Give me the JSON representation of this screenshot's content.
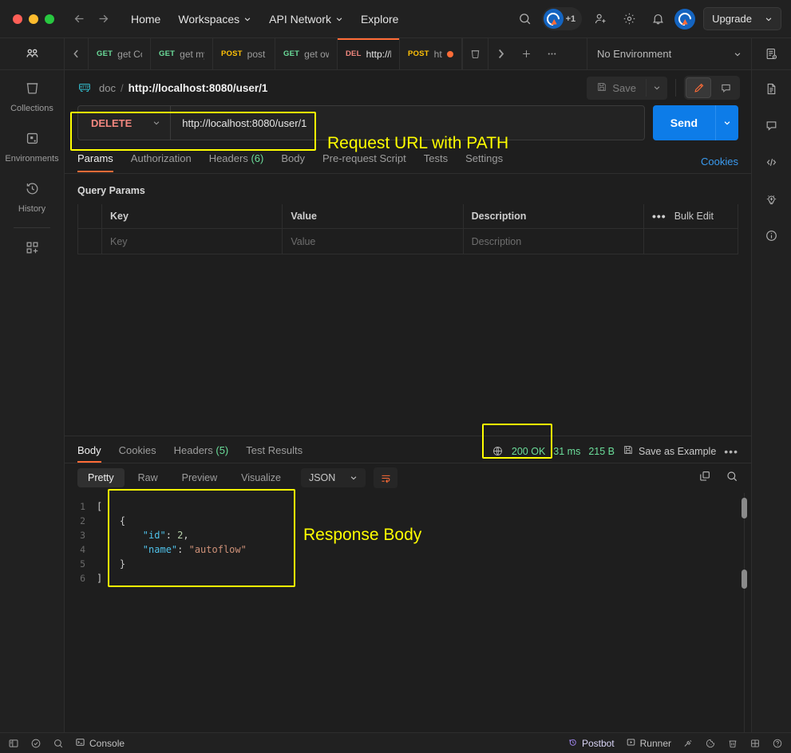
{
  "titlebar": {
    "back_icon": "arrow-left-icon",
    "forward_icon": "arrow-right-icon",
    "nav": [
      {
        "label": "Home",
        "caret": false
      },
      {
        "label": "Workspaces",
        "caret": true
      },
      {
        "label": "API Network",
        "caret": true
      },
      {
        "label": "Explore",
        "caret": false
      }
    ],
    "search_icon": "search-icon",
    "avatar_plus_count": "+1",
    "invite_icon": "user-plus-icon",
    "settings_icon": "gear-icon",
    "notifications_icon": "bell-icon",
    "account_icon": "postman-avatar-icon",
    "upgrade_label": "Upgrade"
  },
  "left_rail": {
    "top_icon": "team-icon",
    "items": [
      {
        "label": "Collections",
        "icon": "collections-icon"
      },
      {
        "label": "Environments",
        "icon": "environments-icon"
      },
      {
        "label": "History",
        "icon": "history-icon"
      }
    ],
    "new_icon": "new-modules-icon"
  },
  "tabstrip": {
    "scroll_left_icon": "chevron-left-icon",
    "tabs": [
      {
        "method": "GET",
        "method_class": "m-get",
        "name": "get Co",
        "active": false,
        "unsaved": false
      },
      {
        "method": "GET",
        "method_class": "m-get",
        "name": "get my",
        "active": false,
        "unsaved": false
      },
      {
        "method": "POST",
        "method_class": "m-post",
        "name": "post r",
        "active": false,
        "unsaved": false
      },
      {
        "method": "GET",
        "method_class": "m-get",
        "name": "get ow",
        "active": false,
        "unsaved": false
      },
      {
        "method": "DEL",
        "method_class": "m-del",
        "name": "http://l",
        "active": true,
        "unsaved": false
      },
      {
        "method": "POST",
        "method_class": "m-post",
        "name": "http",
        "active": false,
        "unsaved": true
      }
    ],
    "trash_icon": "trash-icon",
    "scroll_right_icon": "chevron-right-icon",
    "new_tab_icon": "plus-icon",
    "more_icon": "ellipsis-icon",
    "environment_label": "No Environment",
    "env_caret_icon": "chevron-down-icon",
    "env_eye_icon": "environment-quick-look-icon"
  },
  "breadcrumb": {
    "http_icon": "http-protocol-icon",
    "collection": "doc",
    "separator": "/",
    "title": "http://localhost:8080/user/1",
    "save_label": "Save",
    "save_icon": "floppy-disk-icon",
    "save_caret_icon": "chevron-down-icon",
    "edit_icon": "pencil-icon",
    "comment_icon": "comment-icon",
    "docs_icon": "document-icon"
  },
  "request": {
    "method": "DELETE",
    "method_caret_icon": "chevron-down-icon",
    "url": "http://localhost:8080/user/1",
    "send_label": "Send",
    "send_caret_icon": "chevron-down-icon",
    "tabs": [
      {
        "label": "Params",
        "count": "",
        "active": true
      },
      {
        "label": "Authorization",
        "count": "",
        "active": false
      },
      {
        "label": "Headers",
        "count": "(6)",
        "active": false
      },
      {
        "label": "Body",
        "count": "",
        "active": false
      },
      {
        "label": "Pre-request Script",
        "count": "",
        "active": false
      },
      {
        "label": "Tests",
        "count": "",
        "active": false
      },
      {
        "label": "Settings",
        "count": "",
        "active": false
      }
    ],
    "cookies_link": "Cookies",
    "query_params_title": "Query Params",
    "table": {
      "headers": [
        "Key",
        "Value",
        "Description"
      ],
      "bulk_edit_label": "Bulk Edit",
      "more_icon": "ellipsis-icon",
      "placeholder_row": [
        "Key",
        "Value",
        "Description"
      ]
    }
  },
  "response": {
    "tabs": [
      {
        "label": "Body",
        "count": "",
        "active": true
      },
      {
        "label": "Cookies",
        "count": "",
        "active": false
      },
      {
        "label": "Headers",
        "count": "(5)",
        "active": false
      },
      {
        "label": "Test Results",
        "count": "",
        "active": false
      }
    ],
    "globe_icon": "globe-icon",
    "status": "200 OK",
    "time": "31 ms",
    "size": "215 B",
    "save_example_label": "Save as Example",
    "save_example_icon": "floppy-disk-icon",
    "more_icon": "ellipsis-icon",
    "format_tabs": [
      {
        "label": "Pretty",
        "active": true
      },
      {
        "label": "Raw",
        "active": false
      },
      {
        "label": "Preview",
        "active": false
      },
      {
        "label": "Visualize",
        "active": false
      }
    ],
    "language": "JSON",
    "language_caret_icon": "chevron-down-icon",
    "wrap_icon": "word-wrap-icon",
    "copy_icon": "copy-icon",
    "search_icon": "search-icon",
    "line_numbers": [
      "1",
      "2",
      "3",
      "4",
      "5",
      "6"
    ],
    "body_lines": [
      {
        "segments": [
          {
            "t": "[",
            "c": "tok-brk"
          }
        ]
      },
      {
        "segments": [
          {
            "t": "    ",
            "c": ""
          },
          {
            "t": "{",
            "c": "tok-brk"
          }
        ]
      },
      {
        "segments": [
          {
            "t": "        ",
            "c": ""
          },
          {
            "t": "\"id\"",
            "c": "tok-key"
          },
          {
            "t": ": ",
            "c": "tok-punc"
          },
          {
            "t": "2",
            "c": "tok-num"
          },
          {
            "t": ",",
            "c": "tok-punc"
          }
        ]
      },
      {
        "segments": [
          {
            "t": "        ",
            "c": ""
          },
          {
            "t": "\"name\"",
            "c": "tok-key"
          },
          {
            "t": ": ",
            "c": "tok-punc"
          },
          {
            "t": "\"autoflow\"",
            "c": "tok-str"
          }
        ]
      },
      {
        "segments": [
          {
            "t": "    ",
            "c": ""
          },
          {
            "t": "}",
            "c": "tok-brk"
          }
        ]
      },
      {
        "segments": [
          {
            "t": "]",
            "c": "tok-brk"
          }
        ]
      }
    ]
  },
  "right_rail": {
    "top_icon": "environment-quick-look-icon",
    "items": [
      {
        "icon": "documentation-icon"
      },
      {
        "icon": "comments-icon"
      },
      {
        "icon": "code-snippet-icon"
      },
      {
        "icon": "postbot-lightbulb-icon"
      },
      {
        "icon": "info-icon"
      }
    ]
  },
  "statusbar": {
    "sidebar_icon": "toggle-sidebar-icon",
    "check_icon": "check-circle-icon",
    "search_icon": "search-icon",
    "console_label": "Console",
    "console_icon": "console-icon",
    "postbot_label": "Postbot",
    "postbot_icon": "postbot-icon",
    "runner_label": "Runner",
    "runner_icon": "play-icon",
    "tools": [
      "capture-icon",
      "cookies-icon",
      "trash-icon",
      "layout-icon",
      "help-icon"
    ]
  },
  "annotations": [
    {
      "id": "url-anno",
      "text": "Request URL with PATH"
    },
    {
      "id": "status-anno",
      "text": ""
    },
    {
      "id": "body-anno",
      "text": "Response Body"
    }
  ],
  "colors": {
    "accent": "#ff6c37",
    "send_blue": "#0d7ce8",
    "success_green": "#6bdd9a",
    "annotation_yellow": "#ffff00",
    "delete_red": "#f2877f"
  }
}
